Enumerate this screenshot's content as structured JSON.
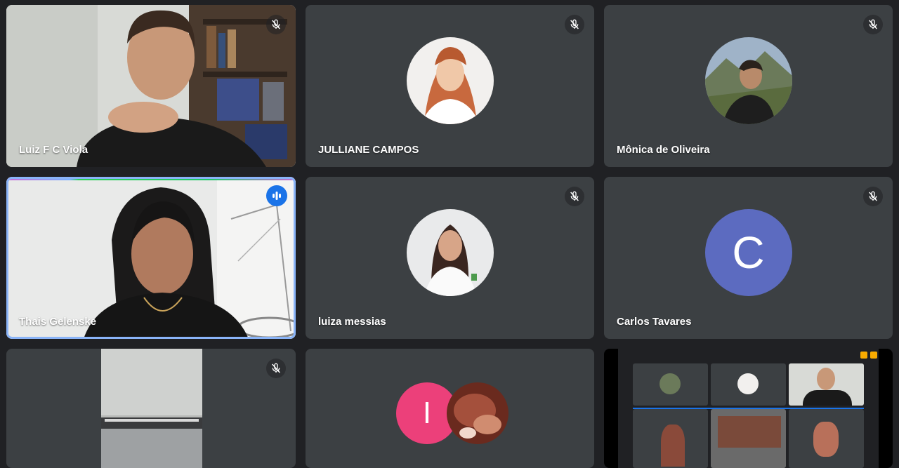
{
  "participants": [
    {
      "name": "Luiz F C Viola",
      "mic": "muted",
      "view": "camera"
    },
    {
      "name": "JULLIANE CAMPOS",
      "mic": "muted",
      "view": "photo"
    },
    {
      "name": "Mônica de Oliveira",
      "mic": "muted",
      "view": "photo"
    },
    {
      "name": "Thais Gelenske",
      "mic": "speaking",
      "view": "camera"
    },
    {
      "name": "luiza messias",
      "mic": "muted",
      "view": "photo"
    },
    {
      "name": "Carlos Tavares",
      "mic": "muted",
      "view": "letter",
      "initial": "C"
    },
    {
      "name": "",
      "mic": "muted",
      "view": "camera"
    },
    {
      "name": "",
      "mic": "unknown",
      "view": "avatars",
      "initial": "I"
    },
    {
      "name": "",
      "mic": "unknown",
      "view": "screen-share"
    }
  ],
  "colors": {
    "background": "#202124",
    "tile": "#3c4043",
    "speaking_accent": "#1a73e8",
    "active_border": "#8ab4f8",
    "letter_avatar": "#5c6bc0",
    "pink_avatar": "#ec407a"
  },
  "icons": [
    "mic-off-icon",
    "audio-level-icon"
  ]
}
